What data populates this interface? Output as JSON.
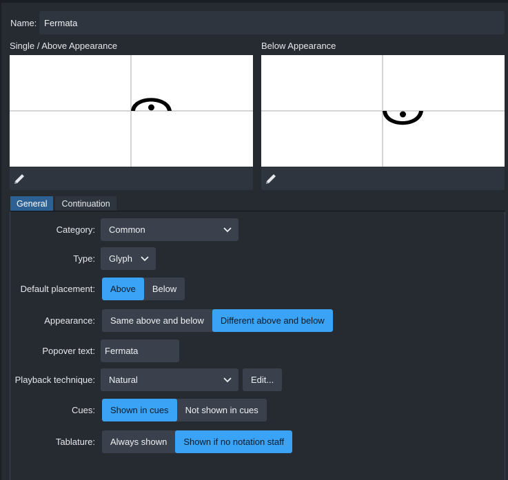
{
  "name": {
    "label": "Name:",
    "value": "Fermata"
  },
  "previews": {
    "above": {
      "label": "Single / Above Appearance"
    },
    "below": {
      "label": "Below Appearance"
    },
    "edit_icon": "pencil-icon"
  },
  "tabs": [
    {
      "label": "General",
      "active": true
    },
    {
      "label": "Continuation",
      "active": false
    }
  ],
  "form": {
    "category": {
      "label": "Category:",
      "value": "Common"
    },
    "type": {
      "label": "Type:",
      "value": "Glyph"
    },
    "default_placement": {
      "label": "Default placement:",
      "options": [
        "Above",
        "Below"
      ],
      "selected": "Above"
    },
    "appearance": {
      "label": "Appearance:",
      "options": [
        "Same above and below",
        "Different above and below"
      ],
      "selected": "Different above and below"
    },
    "popover_text": {
      "label": "Popover text:",
      "value": "Fermata"
    },
    "playback_technique": {
      "label": "Playback technique:",
      "value": "Natural",
      "edit_label": "Edit..."
    },
    "cues": {
      "label": "Cues:",
      "options": [
        "Shown in cues",
        "Not shown in cues"
      ],
      "selected": "Shown in cues"
    },
    "tablature": {
      "label": "Tablature:",
      "options": [
        "Always shown",
        "Shown if no notation staff"
      ],
      "selected": "Shown if no notation staff"
    }
  },
  "colors": {
    "accent": "#3aa3f5",
    "tab_active": "#2e6193",
    "background": "#262b32",
    "control": "#3a414c"
  }
}
